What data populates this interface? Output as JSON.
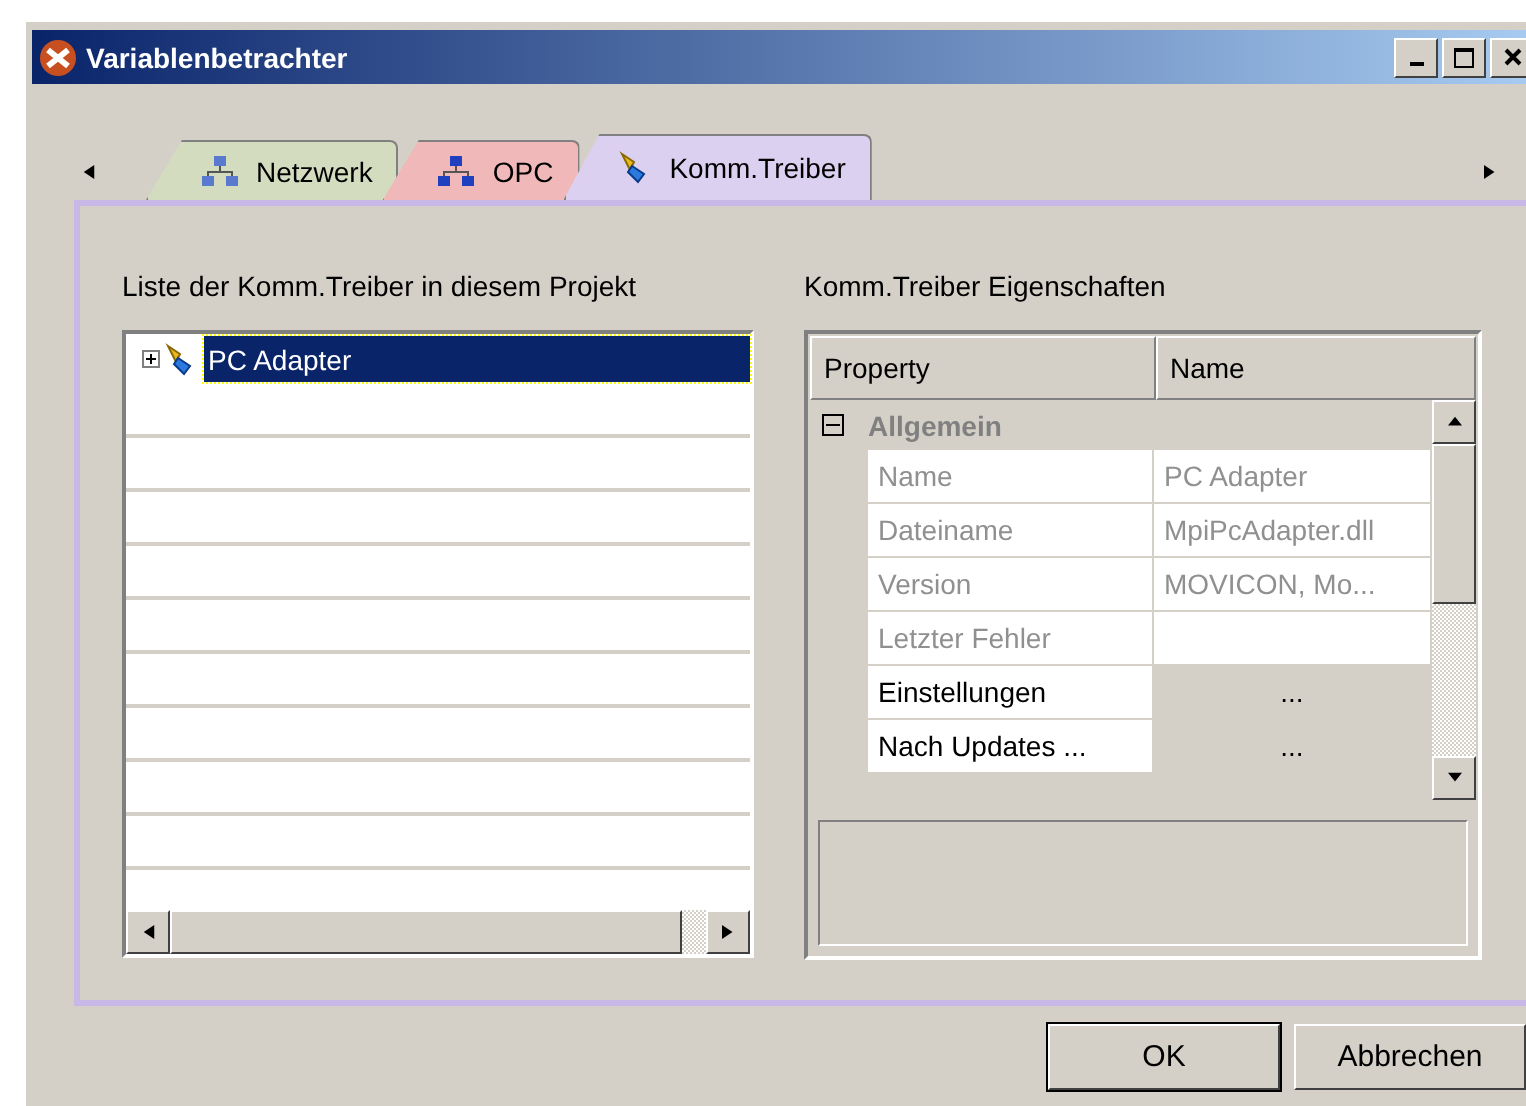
{
  "window": {
    "title": "Variablenbetrachter"
  },
  "tabs": [
    {
      "label": "Netzwerk",
      "selected": false,
      "color": "#d4dcc0"
    },
    {
      "label": "OPC",
      "selected": false,
      "color": "#f0b8b8"
    },
    {
      "label": "Komm.Treiber",
      "selected": true,
      "color": "#dcd0f0"
    }
  ],
  "driver_list": {
    "label": "Liste der Komm.Treiber in diesem Projekt",
    "items": [
      {
        "label": "PC Adapter",
        "selected": true,
        "expanded": false
      }
    ]
  },
  "properties": {
    "label": "Komm.Treiber Eigenschaften",
    "columns": [
      "Property",
      "Name"
    ],
    "group": {
      "label": "Allgemein",
      "expanded": true
    },
    "rows": [
      {
        "property": "Name",
        "value": "PC Adapter",
        "disabled": true
      },
      {
        "property": "Dateiname",
        "value": "MpiPcAdapter.dll",
        "disabled": true
      },
      {
        "property": "Version",
        "value": "MOVICON, Mo...",
        "disabled": true
      },
      {
        "property": "Letzter Fehler",
        "disabled": true
      },
      {
        "property": "Einstellungen",
        "value": "...",
        "disabled": false
      },
      {
        "property": "Nach Updates ...",
        "value": "...",
        "disabled": false
      }
    ]
  },
  "buttons": [
    "OK",
    "Abbrechen"
  ]
}
